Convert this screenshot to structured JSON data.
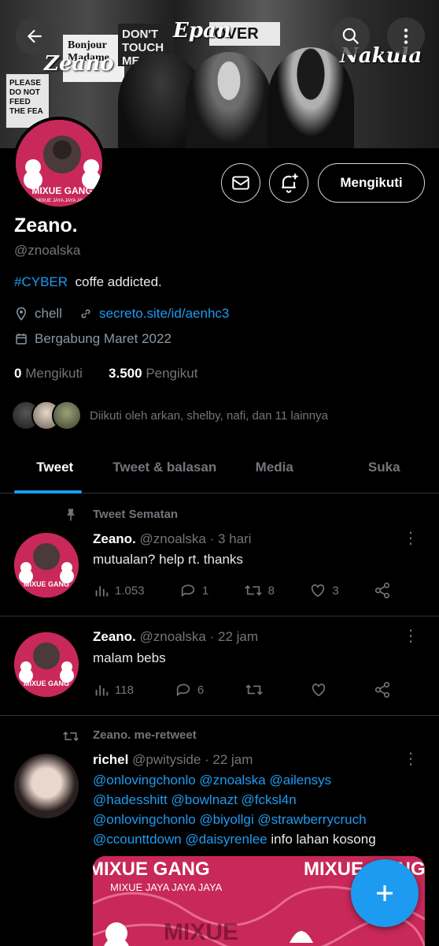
{
  "banner": {
    "poster_1": "PLEASE DO NOT FEED THE FEA",
    "poster_2": "Bonjour Madame",
    "poster_3": "DON'T TOUCH ME",
    "poster_4": "OVER",
    "signature_1": "Epan",
    "signature_2": "Zeano",
    "signature_3": "Nakula"
  },
  "avatar_logo": {
    "title": "MIXUE GANG",
    "subtitle": "MIXUE JAYA JAYA JAYA"
  },
  "profile": {
    "follow_label": "Mengikuti",
    "name": "Zeano.",
    "handle": "@znoalska",
    "bio_hashtag": "#CYBER",
    "bio_text": "coffe addicted.",
    "location": "chell",
    "website": "secreto.site/id/aenhc3",
    "joined": "Bergabung Maret 2022",
    "following_count": "0",
    "following_label": "Mengikuti",
    "followers_count": "3.500",
    "followers_label": "Pengikut",
    "followed_by": "Diikuti oleh arkan, shelby, nafi, dan 11 lainnya"
  },
  "tabs": [
    "Tweet",
    "Tweet & balasan",
    "Media",
    "Suka"
  ],
  "tweets": [
    {
      "context": "Tweet Sematan",
      "name": "Zeano.",
      "handle": "@znoalska",
      "time": "· 3 hari",
      "text": "mutualan? help rt. thanks",
      "views": "1.053",
      "replies": "1",
      "retweets": "8",
      "likes": "3"
    },
    {
      "name": "Zeano.",
      "handle": "@znoalska",
      "time": "· 22 jam",
      "text": "malam bebs",
      "views": "118",
      "replies": "6",
      "retweets": "",
      "likes": ""
    },
    {
      "context": "Zeano. me-retweet",
      "name": "richel",
      "handle": "@pwityside",
      "time": "· 22 jam",
      "line1": "@onlovingchonlo @znoalska @ailensys",
      "line2": "@hadesshitt @bowlnazt @fcksl4n",
      "line3": "@onlovingchonlo @biyollgi @strawberrycruch",
      "line4_mentions": "@ccounttdown @daisyrenlee",
      "line4_text": "info lahan kosong"
    }
  ],
  "media_card": {
    "title_left": "MIXUE GANG",
    "sub_left": "MIXUE JAYA JAYA JAYA",
    "title_right": "MIXUE GANG",
    "brand": "MIXUE"
  },
  "colors": {
    "accent": "#1d9bf0",
    "brand_pink": "#c8285a",
    "muted": "#71767b"
  }
}
